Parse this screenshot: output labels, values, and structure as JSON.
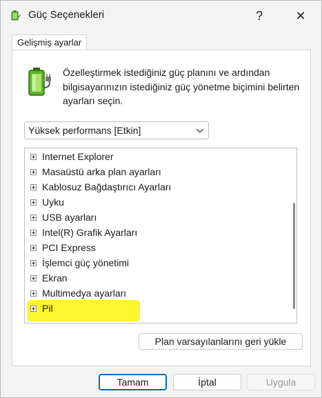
{
  "window": {
    "title": "Güç Seçenekleri",
    "help_symbol": "?",
    "close_symbol": "✕"
  },
  "tab": {
    "label": "Gelişmiş ayarlar"
  },
  "description": "Özelleştirmek istediğiniz güç planını ve ardından bilgisayarınızın istediğiniz güç yönetme biçimini belirten ayarları seçin.",
  "plan_select": {
    "value": "Yüksek performans [Etkin]"
  },
  "tree": {
    "items": [
      {
        "label": "Internet Explorer"
      },
      {
        "label": "Masaüstü arka plan ayarları"
      },
      {
        "label": "Kablosuz Bağdaştırıcı Ayarları"
      },
      {
        "label": "Uyku"
      },
      {
        "label": "USB ayarları"
      },
      {
        "label": "Intel(R) Grafik Ayarları"
      },
      {
        "label": "PCI Express"
      },
      {
        "label": "İşlemci güç yönetimi"
      },
      {
        "label": "Ekran"
      },
      {
        "label": "Multimedya ayarları"
      },
      {
        "label": "Pil"
      }
    ]
  },
  "buttons": {
    "restore": "Plan varsayılanlarını geri yükle",
    "ok": "Tamam",
    "cancel": "İptal",
    "apply": "Uygula"
  },
  "colors": {
    "highlight": "#fbf30d",
    "accent": "#0067c0"
  },
  "icons": {
    "title": "power-options-battery-icon",
    "panel": "battery-plug-icon"
  }
}
